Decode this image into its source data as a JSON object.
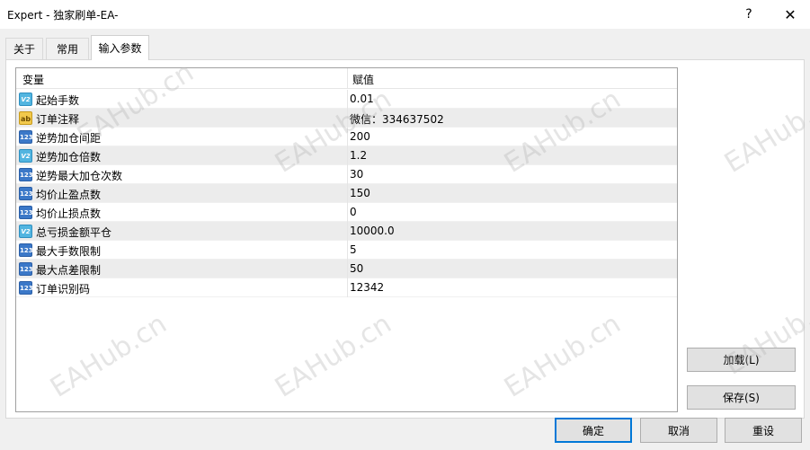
{
  "window": {
    "title": "Expert - 独家刷单-EA-",
    "help_label": "?",
    "close_label": "✕"
  },
  "tabs": [
    {
      "label": "关于"
    },
    {
      "label": "常用"
    },
    {
      "label": "输入参数"
    }
  ],
  "grid": {
    "columns": [
      "变量",
      "赋值"
    ],
    "rows": [
      {
        "type": "double",
        "icon": "V2",
        "name": "起始手数",
        "value": "0.01"
      },
      {
        "type": "string",
        "icon": "ab",
        "name": "订单注释",
        "value": "微信：334637502"
      },
      {
        "type": "int",
        "icon": "123",
        "name": "逆势加仓间距",
        "value": "200"
      },
      {
        "type": "double",
        "icon": "V2",
        "name": "逆势加仓倍数",
        "value": "1.2"
      },
      {
        "type": "int",
        "icon": "123",
        "name": "逆势最大加仓次数",
        "value": "30"
      },
      {
        "type": "int",
        "icon": "123",
        "name": "均价止盈点数",
        "value": "150"
      },
      {
        "type": "int",
        "icon": "123",
        "name": "均价止损点数",
        "value": "0"
      },
      {
        "type": "double",
        "icon": "V2",
        "name": "总亏损金额平仓",
        "value": "10000.0"
      },
      {
        "type": "int",
        "icon": "123",
        "name": "最大手数限制",
        "value": "5"
      },
      {
        "type": "int",
        "icon": "123",
        "name": "最大点差限制",
        "value": "50"
      },
      {
        "type": "int",
        "icon": "123",
        "name": "订单识别码",
        "value": "12342"
      }
    ]
  },
  "buttons": {
    "load": "加载(L)",
    "save": "保存(S)",
    "ok": "确定",
    "cancel": "取消",
    "reset": "重设"
  },
  "watermark": "EAHub.cn"
}
